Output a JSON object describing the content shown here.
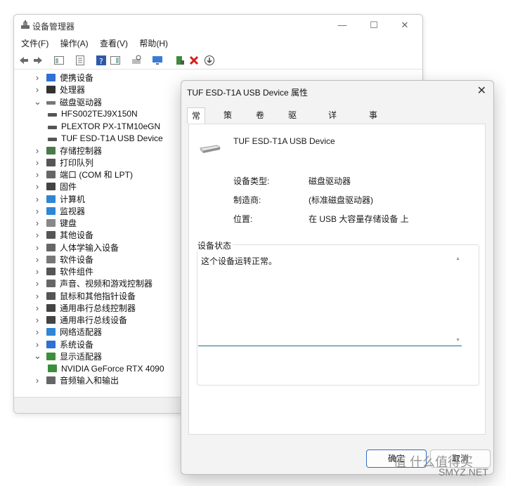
{
  "device_manager": {
    "title": "设备管理器",
    "menu": [
      "文件(F)",
      "操作(A)",
      "查看(V)",
      "帮助(H)"
    ],
    "tree": [
      {
        "label": "便携设备",
        "expanded": false,
        "level": 0,
        "icon": "portable-device-icon"
      },
      {
        "label": "处理器",
        "expanded": false,
        "level": 0,
        "icon": "processor-icon"
      },
      {
        "label": "磁盘驱动器",
        "expanded": true,
        "level": 0,
        "icon": "disk-drive-icon"
      },
      {
        "label": "HFS002TEJ9X150N",
        "level": 1,
        "icon": "disk-icon"
      },
      {
        "label": "PLEXTOR PX-1TM10eGN",
        "level": 1,
        "icon": "disk-icon"
      },
      {
        "label": "TUF ESD-T1A USB Device",
        "level": 1,
        "icon": "disk-icon"
      },
      {
        "label": "存储控制器",
        "expanded": false,
        "level": 0,
        "icon": "storage-controller-icon"
      },
      {
        "label": "打印队列",
        "expanded": false,
        "level": 0,
        "icon": "printer-icon"
      },
      {
        "label": "端口 (COM 和 LPT)",
        "expanded": false,
        "level": 0,
        "icon": "port-icon"
      },
      {
        "label": "固件",
        "expanded": false,
        "level": 0,
        "icon": "firmware-icon"
      },
      {
        "label": "计算机",
        "expanded": false,
        "level": 0,
        "icon": "computer-icon"
      },
      {
        "label": "监视器",
        "expanded": false,
        "level": 0,
        "icon": "monitor-icon"
      },
      {
        "label": "键盘",
        "expanded": false,
        "level": 0,
        "icon": "keyboard-icon"
      },
      {
        "label": "其他设备",
        "expanded": false,
        "level": 0,
        "icon": "other-device-icon"
      },
      {
        "label": "人体学输入设备",
        "expanded": false,
        "level": 0,
        "icon": "hid-icon"
      },
      {
        "label": "软件设备",
        "expanded": false,
        "level": 0,
        "icon": "software-device-icon"
      },
      {
        "label": "软件组件",
        "expanded": false,
        "level": 0,
        "icon": "software-component-icon"
      },
      {
        "label": "声音、视频和游戏控制器",
        "expanded": false,
        "level": 0,
        "icon": "sound-icon"
      },
      {
        "label": "鼠标和其他指针设备",
        "expanded": false,
        "level": 0,
        "icon": "mouse-icon"
      },
      {
        "label": "通用串行总线控制器",
        "expanded": false,
        "level": 0,
        "icon": "usb-icon"
      },
      {
        "label": "通用串行总线设备",
        "expanded": false,
        "level": 0,
        "icon": "usb-icon"
      },
      {
        "label": "网络适配器",
        "expanded": false,
        "level": 0,
        "icon": "network-icon"
      },
      {
        "label": "系统设备",
        "expanded": false,
        "level": 0,
        "icon": "system-device-icon"
      },
      {
        "label": "显示适配器",
        "expanded": true,
        "level": 0,
        "icon": "display-adapter-icon"
      },
      {
        "label": "NVIDIA GeForce RTX 4090",
        "level": 1,
        "icon": "display-adapter-icon"
      },
      {
        "label": "音频输入和输出",
        "expanded": false,
        "level": 0,
        "icon": "audio-icon"
      }
    ]
  },
  "dialog": {
    "title": "TUF ESD-T1A USB Device 属性",
    "tabs": [
      "常规",
      "策略",
      "卷",
      "驱动程序",
      "详细信息",
      "事件"
    ],
    "device_name": "TUF ESD-T1A USB Device",
    "props": [
      {
        "label": "设备类型:",
        "value": "磁盘驱动器"
      },
      {
        "label": "制造商:",
        "value": "(标准磁盘驱动器)"
      },
      {
        "label": "位置:",
        "value": "在 USB 大容量存储设备 上"
      }
    ],
    "status_group_title": "设备状态",
    "status_text": "这个设备运转正常。",
    "ok_label": "确定",
    "cancel_label": "取消"
  },
  "watermark": {
    "text": "值 什么值得买",
    "site": "SMYZ.NET"
  }
}
